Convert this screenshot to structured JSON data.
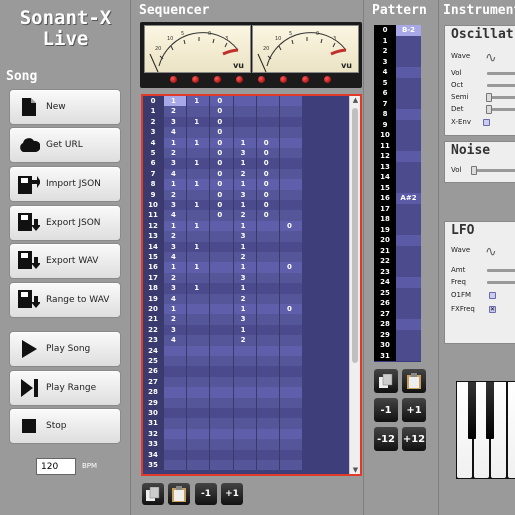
{
  "app": {
    "title_line1": "Sonant-X",
    "title_line2": "Live"
  },
  "song": {
    "heading": "Song",
    "buttons": [
      {
        "label": "New",
        "icon": "new-document-icon"
      },
      {
        "label": "Get URL",
        "icon": "cloud-icon"
      },
      {
        "label": "Import JSON",
        "icon": "import-json-icon"
      },
      {
        "label": "Export JSON",
        "icon": "export-json-icon"
      },
      {
        "label": "Export WAV",
        "icon": "export-wav-icon"
      },
      {
        "label": "Range to WAV",
        "icon": "range-to-wav-icon"
      },
      {
        "label": "Play Song",
        "icon": "play-icon"
      },
      {
        "label": "Play Range",
        "icon": "play-range-icon"
      },
      {
        "label": "Stop",
        "icon": "stop-icon"
      }
    ],
    "bpm_value": "120",
    "bpm_label": "BPM"
  },
  "sequencer": {
    "title": "Sequencer",
    "vu_label": "vu",
    "rows": [
      [
        "0",
        "1",
        "1",
        "0",
        "",
        "",
        ""
      ],
      [
        "1",
        "2",
        "",
        "0",
        "",
        "",
        ""
      ],
      [
        "2",
        "3",
        "1",
        "0",
        "",
        "",
        ""
      ],
      [
        "3",
        "4",
        "",
        "0",
        "",
        "",
        ""
      ],
      [
        "4",
        "1",
        "1",
        "0",
        "1",
        "0",
        ""
      ],
      [
        "5",
        "2",
        "",
        "0",
        "3",
        "0",
        ""
      ],
      [
        "6",
        "3",
        "1",
        "0",
        "1",
        "0",
        ""
      ],
      [
        "7",
        "4",
        "",
        "0",
        "2",
        "0",
        ""
      ],
      [
        "8",
        "1",
        "1",
        "0",
        "1",
        "0",
        ""
      ],
      [
        "9",
        "2",
        "",
        "0",
        "3",
        "0",
        ""
      ],
      [
        "10",
        "3",
        "1",
        "0",
        "1",
        "0",
        ""
      ],
      [
        "11",
        "4",
        "",
        "0",
        "2",
        "0",
        ""
      ],
      [
        "12",
        "1",
        "1",
        "",
        "1",
        "",
        "0"
      ],
      [
        "13",
        "2",
        "",
        "",
        "3",
        "",
        ""
      ],
      [
        "14",
        "3",
        "1",
        "",
        "1",
        "",
        ""
      ],
      [
        "15",
        "4",
        "",
        "",
        "2",
        "",
        ""
      ],
      [
        "16",
        "1",
        "1",
        "",
        "1",
        "",
        "0"
      ],
      [
        "17",
        "2",
        "",
        "",
        "3",
        "",
        ""
      ],
      [
        "18",
        "3",
        "1",
        "",
        "1",
        "",
        ""
      ],
      [
        "19",
        "4",
        "",
        "",
        "2",
        "",
        ""
      ],
      [
        "20",
        "1",
        "",
        "",
        "1",
        "",
        "0"
      ],
      [
        "21",
        "2",
        "",
        "",
        "3",
        "",
        ""
      ],
      [
        "22",
        "3",
        "",
        "",
        "1",
        "",
        ""
      ],
      [
        "23",
        "4",
        "",
        "",
        "2",
        "",
        ""
      ],
      [
        "24",
        "",
        "",
        "",
        "",
        "",
        ""
      ],
      [
        "25",
        "",
        "",
        "",
        "",
        "",
        ""
      ],
      [
        "26",
        "",
        "",
        "",
        "",
        "",
        ""
      ],
      [
        "27",
        "",
        "",
        "",
        "",
        "",
        ""
      ],
      [
        "28",
        "",
        "",
        "",
        "",
        "",
        ""
      ],
      [
        "29",
        "",
        "",
        "",
        "",
        "",
        ""
      ],
      [
        "30",
        "",
        "",
        "",
        "",
        "",
        ""
      ],
      [
        "31",
        "",
        "",
        "",
        "",
        "",
        ""
      ],
      [
        "32",
        "",
        "",
        "",
        "",
        "",
        ""
      ],
      [
        "33",
        "",
        "",
        "",
        "",
        "",
        ""
      ],
      [
        "34",
        "",
        "",
        "",
        "",
        "",
        ""
      ],
      [
        "35",
        "",
        "",
        "",
        "",
        "",
        ""
      ]
    ],
    "buttons": [
      "",
      "",
      "-1",
      "+1"
    ]
  },
  "pattern": {
    "title": "Pattern",
    "rows": [
      [
        "0",
        "B-2"
      ],
      [
        "1",
        ""
      ],
      [
        "2",
        ""
      ],
      [
        "3",
        ""
      ],
      [
        "4",
        ""
      ],
      [
        "5",
        ""
      ],
      [
        "6",
        ""
      ],
      [
        "7",
        ""
      ],
      [
        "8",
        ""
      ],
      [
        "9",
        ""
      ],
      [
        "10",
        ""
      ],
      [
        "11",
        ""
      ],
      [
        "12",
        ""
      ],
      [
        "13",
        ""
      ],
      [
        "14",
        ""
      ],
      [
        "15",
        ""
      ],
      [
        "16",
        "A#2"
      ],
      [
        "17",
        ""
      ],
      [
        "18",
        ""
      ],
      [
        "19",
        ""
      ],
      [
        "20",
        ""
      ],
      [
        "21",
        ""
      ],
      [
        "22",
        ""
      ],
      [
        "23",
        ""
      ],
      [
        "24",
        ""
      ],
      [
        "25",
        ""
      ],
      [
        "26",
        ""
      ],
      [
        "27",
        ""
      ],
      [
        "28",
        ""
      ],
      [
        "29",
        ""
      ],
      [
        "30",
        ""
      ],
      [
        "31",
        ""
      ]
    ],
    "buttons": [
      "",
      "",
      "-1",
      "+1",
      "-12",
      "+12"
    ]
  },
  "instrument": {
    "title": "Instrument",
    "oscillator": {
      "title": "Oscillat",
      "rows": [
        "Wave",
        "Vol",
        "Oct",
        "Semi",
        "Det",
        "X-Env"
      ]
    },
    "noise": {
      "title": "Noise",
      "vol_label": "Vol"
    },
    "lfo": {
      "title": "LFO",
      "rows": [
        "Wave",
        "Amt",
        "Freq",
        "O1FM",
        "FXFreq"
      ]
    }
  },
  "colors": {
    "grid_bg": "#4a4a8c",
    "selection": "#a8a8e8",
    "sequencer_border": "#e23a2a",
    "button_dark": "#1a1a1a"
  }
}
